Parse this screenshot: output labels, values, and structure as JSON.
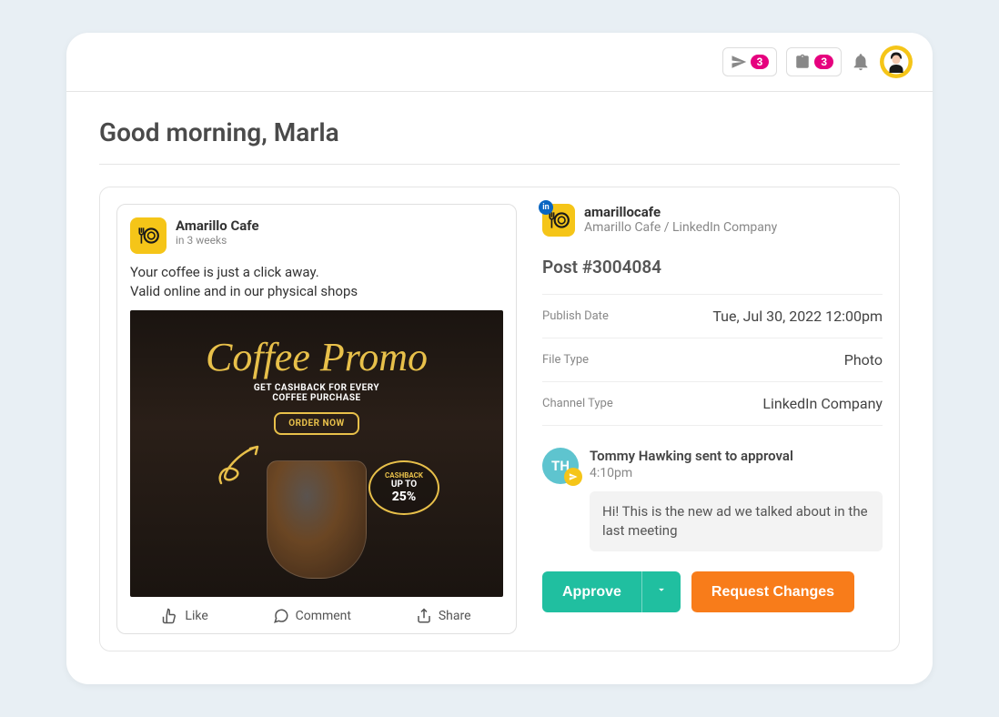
{
  "header": {
    "sent_count": "3",
    "tasks_count": "3"
  },
  "greeting": "Good morning, Marla",
  "post": {
    "brand_name": "Amarillo Cafe",
    "schedule": "in 3 weeks",
    "text_line1": "Your coffee is just a click away.",
    "text_line2": "Valid online and in our physical shops",
    "promo": {
      "title": "Coffee Promo",
      "sub_line1": "GET CASHBACK FOR EVERY",
      "sub_line2": "COFFEE PURCHASE",
      "order_btn": "ORDER NOW",
      "cashback_label": "CASHBACK",
      "cashback_upto": "UP TO",
      "cashback_value": "25%"
    },
    "actions": {
      "like": "Like",
      "comment": "Comment",
      "share": "Share"
    }
  },
  "channel": {
    "handle": "amarillocafe",
    "desc": "Amarillo Cafe / LinkedIn Company",
    "network_badge": "in"
  },
  "post_id": "Post #3004084",
  "meta": {
    "publish_label": "Publish Date",
    "publish_value": "Tue, Jul 30, 2022 12:00pm",
    "filetype_label": "File Type",
    "filetype_value": "Photo",
    "channeltype_label": "Channel Type",
    "channeltype_value": "LinkedIn Company"
  },
  "activity": {
    "avatar_initials": "TH",
    "title": "Tommy Hawking sent to approval",
    "time": "4:10pm",
    "message": "Hi! This is the new ad we talked about in the last meeting"
  },
  "actions": {
    "approve": "Approve",
    "request": "Request Changes"
  }
}
